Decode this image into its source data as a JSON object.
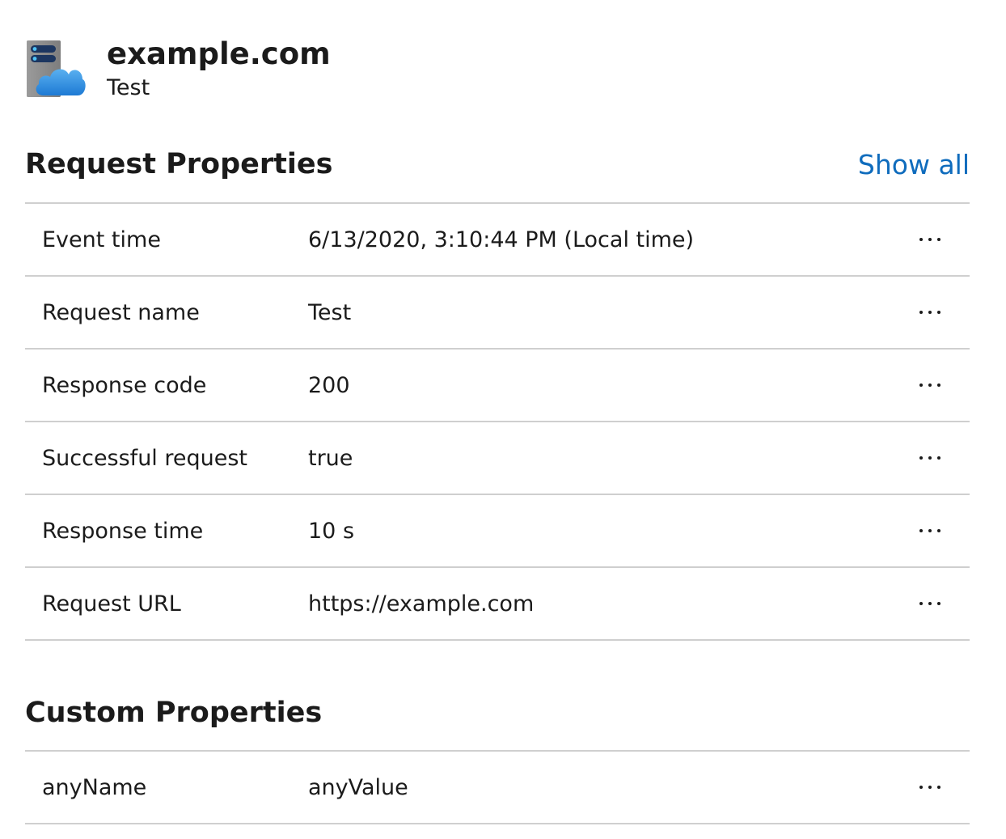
{
  "header": {
    "title": "example.com",
    "subtitle": "Test",
    "icon": "server-cloud-icon"
  },
  "request_properties": {
    "title": "Request Properties",
    "show_all_label": "Show all",
    "rows": [
      {
        "name": "Event time",
        "value": "6/13/2020, 3:10:44 PM (Local time)"
      },
      {
        "name": "Request name",
        "value": "Test"
      },
      {
        "name": "Response code",
        "value": "200"
      },
      {
        "name": "Successful request",
        "value": "true"
      },
      {
        "name": "Response time",
        "value": "10 s"
      },
      {
        "name": "Request URL",
        "value": "https://example.com"
      }
    ]
  },
  "custom_properties": {
    "title": "Custom Properties",
    "rows": [
      {
        "name": "anyName",
        "value": "anyValue"
      }
    ]
  },
  "colors": {
    "link": "#0f6cbd",
    "divider": "#cfcfcf",
    "text": "#1b1b1b",
    "cloud": "#3a96dd",
    "server": "#8a8a8a"
  },
  "more_icon": "more-horizontal-icon"
}
